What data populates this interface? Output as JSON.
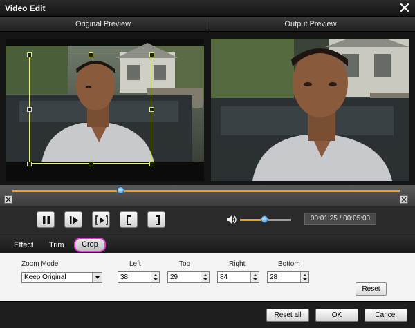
{
  "window": {
    "title": "Video Edit",
    "close_icon": "close-icon"
  },
  "previews": {
    "original_label": "Original Preview",
    "output_label": "Output Preview"
  },
  "playback": {
    "progress_fraction": 0.28,
    "volume_fraction": 0.48,
    "time_display": "00:01:25 / 00:05:00",
    "buttons": [
      "pause-icon",
      "next-frame-icon",
      "play-segment-icon",
      "mark-in-icon",
      "mark-out-icon"
    ],
    "volume_icon": "speaker-icon"
  },
  "tabs": [
    {
      "label": "Effect",
      "active": false
    },
    {
      "label": "Trim",
      "active": false
    },
    {
      "label": "Crop",
      "active": true
    }
  ],
  "crop": {
    "zoom_mode_label": "Zoom Mode",
    "zoom_mode_value": "Keep Original",
    "left_label": "Left",
    "left_value": "38",
    "top_label": "Top",
    "top_value": "29",
    "right_label": "Right",
    "right_value": "84",
    "bottom_label": "Bottom",
    "bottom_value": "28",
    "reset_label": "Reset"
  },
  "footer": {
    "reset_all_label": "Reset all",
    "ok_label": "OK",
    "cancel_label": "Cancel"
  },
  "colors": {
    "accent": "#f0a020",
    "crop_frame": "#e6f07a",
    "highlight": "#e23ad6",
    "thumb": "#3a8fd8"
  }
}
